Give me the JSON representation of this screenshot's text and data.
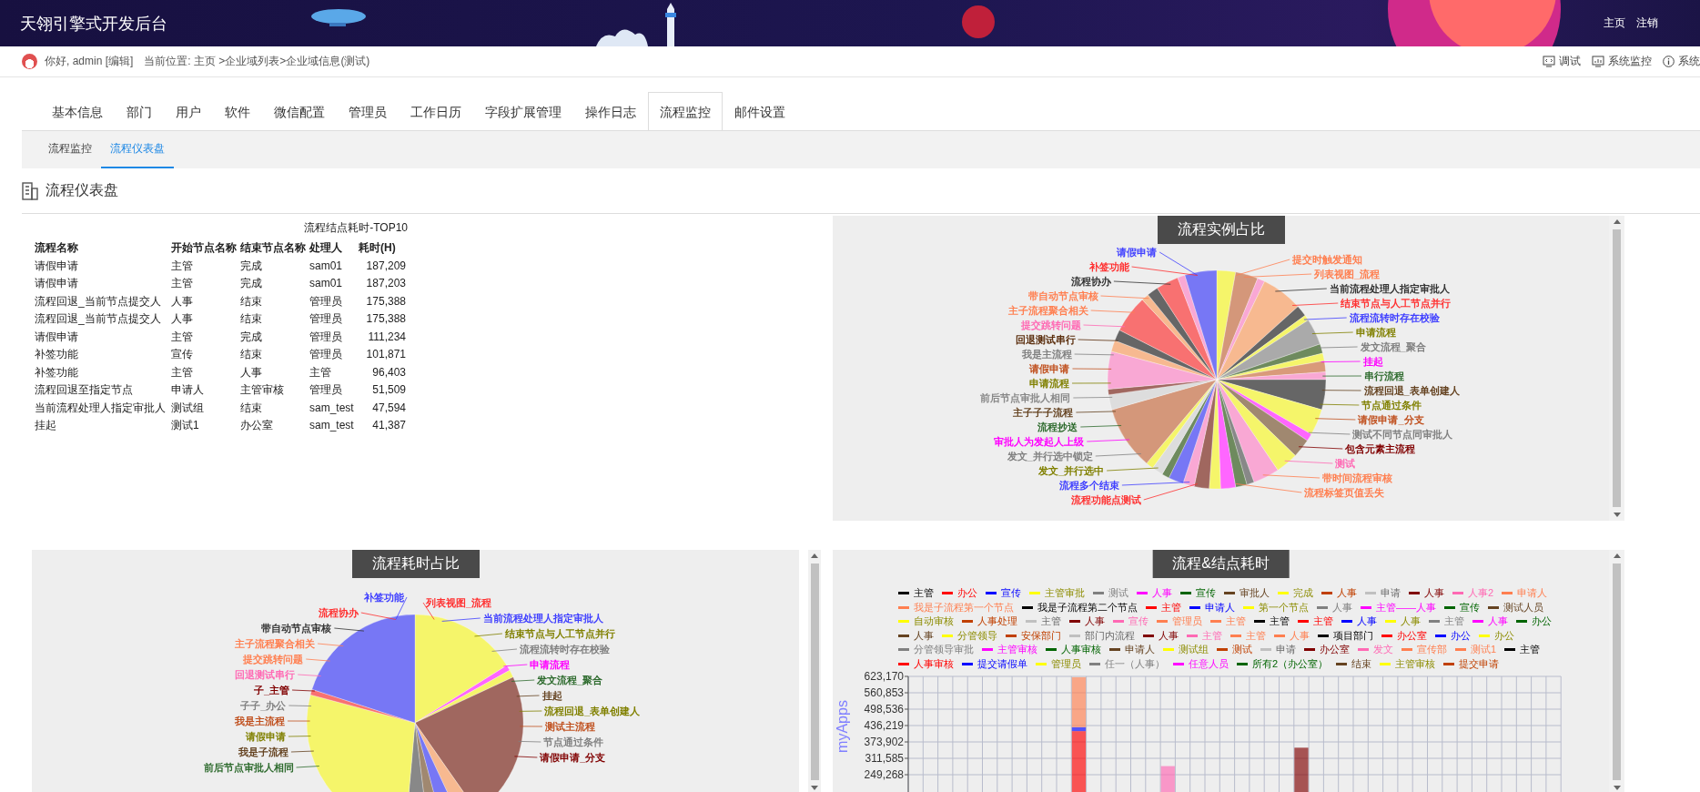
{
  "header": {
    "title": "天翎引擎式开发后台",
    "links": [
      "主页",
      "注销"
    ]
  },
  "user_bar": {
    "greeting": "你好, admin [编辑]",
    "breadcrumb": "当前位置: 主页 >企业域列表>企业域信息(测试)",
    "tools": [
      {
        "label": "调试",
        "kind": "debug"
      },
      {
        "label": "系统监控",
        "kind": "monitor"
      },
      {
        "label": "系统",
        "kind": "info"
      }
    ]
  },
  "tabs": [
    {
      "label": "基本信息",
      "selected": false
    },
    {
      "label": "部门",
      "selected": false
    },
    {
      "label": "用户",
      "selected": false
    },
    {
      "label": "软件",
      "selected": false
    },
    {
      "label": "微信配置",
      "selected": false
    },
    {
      "label": "管理员",
      "selected": false
    },
    {
      "label": "工作日历",
      "selected": false
    },
    {
      "label": "字段扩展管理",
      "selected": false
    },
    {
      "label": "操作日志",
      "selected": false
    },
    {
      "label": "流程监控",
      "selected": true
    },
    {
      "label": "邮件设置",
      "selected": false
    }
  ],
  "sub_tabs": [
    {
      "label": "流程监控",
      "selected": false
    },
    {
      "label": "流程仪表盘",
      "selected": true
    }
  ],
  "page_title": "流程仪表盘",
  "top10_table": {
    "title": "流程结点耗时-TOP10",
    "columns": [
      "流程名称",
      "开始节点名称",
      "结束节点名称",
      "处理人",
      "耗时(H)"
    ],
    "rows": [
      [
        "请假申请",
        "主管",
        "完成",
        "sam01",
        "187,209"
      ],
      [
        "请假申请",
        "主管",
        "完成",
        "sam01",
        "187,203"
      ],
      [
        "流程回退_当前节点提交人",
        "人事",
        "结束",
        "管理员",
        "175,388"
      ],
      [
        "流程回退_当前节点提交人",
        "人事",
        "结束",
        "管理员",
        "175,388"
      ],
      [
        "请假申请",
        "主管",
        "完成",
        "管理员",
        "111,234"
      ],
      [
        "补签功能",
        "宣传",
        "结束",
        "管理员",
        "101,871"
      ],
      [
        "补签功能",
        "主管",
        "人事",
        "主管",
        "96,403"
      ],
      [
        "流程回退至指定节点",
        "申请人",
        "主管审核",
        "管理员",
        "51,509"
      ],
      [
        "当前流程处理人指定审批人",
        "测试组",
        "结束",
        "sam_test",
        "47,594"
      ],
      [
        "挂起",
        "测试1",
        "办公室",
        "sam_test",
        "41,387"
      ]
    ]
  },
  "instance_pie": {
    "title": "流程实例占比",
    "left_labels": [
      {
        "text": "请假申请",
        "color": "#4040ff"
      },
      {
        "text": "补签功能",
        "color": "#ff3030"
      },
      {
        "text": "流程协办",
        "color": "#333333"
      },
      {
        "text": "带自动节点审核",
        "color": "#ff7f50"
      },
      {
        "text": "主子流程聚合相关",
        "color": "#ff7f50"
      },
      {
        "text": "提交跳转问题",
        "color": "#ff69b4"
      },
      {
        "text": "回退测试串行",
        "color": "#5a2d0c"
      },
      {
        "text": "我是主流程",
        "color": "#808080"
      },
      {
        "text": "请假申请",
        "color": "#c0501e"
      },
      {
        "text": "申请流程",
        "color": "#808000"
      },
      {
        "text": "前后节点审批人相同",
        "color": "#888888"
      },
      {
        "text": "主子子子流程",
        "color": "#654321"
      },
      {
        "text": "流程抄送",
        "color": "#2e6b2e"
      },
      {
        "text": "审批人为发起人上级",
        "color": "#ff00ff"
      },
      {
        "text": "发文_并行选中锁定",
        "color": "#808080"
      },
      {
        "text": "发文_并行选中",
        "color": "#808000"
      },
      {
        "text": "流程多个结束",
        "color": "#4040ff"
      },
      {
        "text": "流程功能点测试",
        "color": "#ff3030"
      }
    ],
    "right_labels": [
      {
        "text": "提交时触发通知",
        "color": "#ff7f50"
      },
      {
        "text": "列表视图_流程",
        "color": "#ff7f50"
      },
      {
        "text": "当前流程处理人指定审批人",
        "color": "#333333"
      },
      {
        "text": "结束节点与人工节点并行",
        "color": "#ff3030"
      },
      {
        "text": "流程流转时存在校验",
        "color": "#4040ff"
      },
      {
        "text": "申请流程",
        "color": "#808000"
      },
      {
        "text": "发文流程_聚合",
        "color": "#808080"
      },
      {
        "text": "挂起",
        "color": "#ff00ff"
      },
      {
        "text": "串行流程",
        "color": "#2e6b2e"
      },
      {
        "text": "流程回退_表单创建人",
        "color": "#654321"
      },
      {
        "text": "节点通过条件",
        "color": "#808000"
      },
      {
        "text": "请假申请_分支",
        "color": "#c0501e"
      },
      {
        "text": "测试不同节点同审批人",
        "color": "#808080"
      },
      {
        "text": "包含元素主流程",
        "color": "#800000"
      },
      {
        "text": "测试",
        "color": "#ff69b4"
      },
      {
        "text": "带时间流程审核",
        "color": "#ff7f50"
      },
      {
        "text": "流程标签页值丢失",
        "color": "#ff7f50"
      }
    ]
  },
  "duration_pie": {
    "title": "流程耗时占比",
    "left_labels": [
      {
        "text": "补签功能",
        "color": "#4040ff"
      },
      {
        "text": "流程协办",
        "color": "#ff3030"
      },
      {
        "text": "带自动节点审核",
        "color": "#333333"
      },
      {
        "text": "主子流程聚合相关",
        "color": "#ff7f50"
      },
      {
        "text": "提交跳转问题",
        "color": "#ff7f50"
      },
      {
        "text": "回退测试串行",
        "color": "#ff69b4"
      },
      {
        "text": "子_主管",
        "color": "#800000"
      },
      {
        "text": "子子_办公",
        "color": "#808080"
      },
      {
        "text": "我是主流程",
        "color": "#c0501e"
      },
      {
        "text": "请假申请",
        "color": "#808000"
      },
      {
        "text": "我是子流程",
        "color": "#654321"
      },
      {
        "text": "前后节点审批人相同",
        "color": "#2e6b2e"
      }
    ],
    "right_labels": [
      {
        "text": "列表视图_流程",
        "color": "#ff3030"
      },
      {
        "text": "当前流程处理人指定审批人",
        "color": "#4040ff"
      },
      {
        "text": "结束节点与人工节点并行",
        "color": "#808000"
      },
      {
        "text": "流程流转时存在校验",
        "color": "#808080"
      },
      {
        "text": "申请流程",
        "color": "#ff00ff"
      },
      {
        "text": "发文流程_聚合",
        "color": "#2e6b2e"
      },
      {
        "text": "挂起",
        "color": "#654321"
      },
      {
        "text": "流程回退_表单创建人",
        "color": "#808000"
      },
      {
        "text": "测试主流程",
        "color": "#c0501e"
      },
      {
        "text": "节点通过条件",
        "color": "#808080"
      },
      {
        "text": "请假申请_分支",
        "color": "#800000"
      }
    ]
  },
  "node_duration_chart": {
    "title": "流程&结点耗时",
    "chart_data": {
      "type": "bar",
      "stacked": true,
      "grid": true,
      "legend": "top",
      "ylabel": "myApps",
      "ylim": [
        0,
        623170
      ],
      "yticks": [
        {
          "value": 249268,
          "label": "249,268"
        },
        {
          "value": 311585,
          "label": "311,585"
        },
        {
          "value": 373902,
          "label": "373,902"
        },
        {
          "value": 436219,
          "label": "436,219"
        },
        {
          "value": 498536,
          "label": "498,536"
        },
        {
          "value": 560853,
          "label": "560,853"
        },
        {
          "value": 623170,
          "label": "623,170"
        }
      ],
      "series": [
        {
          "name": "主管",
          "color": "#000000"
        },
        {
          "name": "办公",
          "color": "#ff0000",
          "values": [
            null,
            null,
            null,
            null,
            null,
            null,
            null,
            null,
            null,
            null,
            null,
            415000,
            null,
            null,
            null,
            null,
            null,
            null,
            null,
            null,
            null,
            null,
            null,
            null,
            null,
            null,
            null,
            null,
            null,
            null,
            null,
            null,
            null,
            null,
            null,
            null,
            null,
            null,
            null,
            null,
            null,
            null,
            null,
            null
          ]
        },
        {
          "name": "宣传",
          "color": "#0000ff",
          "values": [
            null,
            null,
            null,
            null,
            null,
            null,
            null,
            null,
            null,
            null,
            null,
            15000,
            null,
            null,
            null,
            null,
            null,
            null,
            null,
            null,
            null,
            null,
            null,
            null,
            null,
            null,
            null,
            null,
            null,
            null,
            null,
            null,
            null,
            null,
            null,
            null,
            null,
            null,
            null,
            null,
            null,
            null,
            null,
            null
          ]
        },
        {
          "name": "主管审批",
          "color": "#ffff00"
        },
        {
          "name": "测试",
          "color": "#808080"
        },
        {
          "name": "人事",
          "color": "#ff00ff"
        },
        {
          "name": "宣传",
          "color": "#006400"
        },
        {
          "name": "审批人",
          "color": "#654321"
        },
        {
          "name": "完成",
          "color": "#ffff00"
        },
        {
          "name": "人事",
          "color": "#c04000"
        },
        {
          "name": "申请",
          "color": "#c0c0c0"
        },
        {
          "name": "人事",
          "color": "#800000",
          "values": [
            null,
            null,
            null,
            null,
            null,
            null,
            null,
            null,
            null,
            null,
            null,
            null,
            null,
            null,
            null,
            null,
            null,
            null,
            null,
            null,
            null,
            null,
            null,
            null,
            null,
            null,
            352000,
            null,
            null,
            null,
            null,
            null,
            null,
            null,
            null,
            null,
            null,
            null,
            null,
            null,
            null,
            null,
            null,
            null
          ]
        },
        {
          "name": "人事2",
          "color": "#ff69b4",
          "values": [
            null,
            null,
            null,
            null,
            null,
            null,
            null,
            null,
            null,
            null,
            null,
            null,
            null,
            null,
            null,
            null,
            null,
            282000,
            null,
            null,
            null,
            null,
            null,
            null,
            null,
            null,
            null,
            null,
            null,
            null,
            null,
            null,
            null,
            null,
            null,
            null,
            null,
            null,
            null,
            null,
            null,
            null,
            null,
            null
          ]
        },
        {
          "name": "申请人",
          "color": "#ff7f50",
          "values": [
            null,
            null,
            null,
            null,
            null,
            null,
            null,
            null,
            null,
            null,
            null,
            190000,
            null,
            null,
            null,
            null,
            null,
            null,
            null,
            null,
            null,
            null,
            null,
            null,
            null,
            null,
            null,
            null,
            null,
            null,
            null,
            null,
            null,
            null,
            null,
            null,
            null,
            null,
            null,
            null,
            null,
            null,
            null,
            null
          ]
        },
        {
          "name": "我是子流程第一个节点",
          "color": "#ff7f50"
        },
        {
          "name": "我是子流程第二个节点",
          "color": "#000000"
        },
        {
          "name": "主管",
          "color": "#ff0000"
        },
        {
          "name": "申请人",
          "color": "#0000ff"
        },
        {
          "name": "第一个节点",
          "color": "#ffff00"
        },
        {
          "name": "人事",
          "color": "#808080"
        },
        {
          "name": "主管——人事",
          "color": "#ff00ff"
        },
        {
          "name": "宣传",
          "color": "#006400"
        },
        {
          "name": "测试人员",
          "color": "#654321"
        },
        {
          "name": "自动审核",
          "color": "#ffff00"
        },
        {
          "name": "人事处理",
          "color": "#c04000"
        },
        {
          "name": "主管",
          "color": "#c0c0c0"
        },
        {
          "name": "人事",
          "color": "#800000"
        },
        {
          "name": "宣传",
          "color": "#ff69b4"
        },
        {
          "name": "管理员",
          "color": "#ff7f50"
        },
        {
          "name": "主管",
          "color": "#ff7f50"
        },
        {
          "name": "主管",
          "color": "#000000"
        },
        {
          "name": "主管",
          "color": "#ff0000"
        },
        {
          "name": "人事",
          "color": "#0000ff"
        },
        {
          "name": "人事",
          "color": "#ffff00"
        },
        {
          "name": "主管",
          "color": "#808080"
        },
        {
          "name": "人事",
          "color": "#ff00ff"
        },
        {
          "name": "办公",
          "color": "#006400"
        },
        {
          "name": "人事",
          "color": "#654321"
        },
        {
          "name": "分管领导",
          "color": "#ffff00"
        },
        {
          "name": "安保部门",
          "color": "#c04000"
        },
        {
          "name": "部门内流程",
          "color": "#c0c0c0"
        },
        {
          "name": "人事",
          "color": "#800000"
        },
        {
          "name": "主管",
          "color": "#ff69b4"
        },
        {
          "name": "主管",
          "color": "#ff7f50"
        },
        {
          "name": "人事",
          "color": "#ff7f50"
        },
        {
          "name": "项目部门",
          "color": "#000000"
        },
        {
          "name": "办公室",
          "color": "#ff0000"
        },
        {
          "name": "办公",
          "color": "#0000ff"
        },
        {
          "name": "办公",
          "color": "#ffff00"
        },
        {
          "name": "分管领导审批",
          "color": "#808080"
        },
        {
          "name": "主管审核",
          "color": "#ff00ff"
        },
        {
          "name": "人事审核",
          "color": "#006400"
        },
        {
          "name": "申请人",
          "color": "#654321"
        },
        {
          "name": "测试组",
          "color": "#ffff00"
        },
        {
          "name": "测试",
          "color": "#c04000"
        },
        {
          "name": "申请",
          "color": "#c0c0c0"
        },
        {
          "name": "办公室",
          "color": "#800000"
        },
        {
          "name": "发文",
          "color": "#ff69b4"
        },
        {
          "name": "宣传部",
          "color": "#ff7f50"
        },
        {
          "name": "测试1",
          "color": "#ff7f50"
        },
        {
          "name": "主管",
          "color": "#000000"
        },
        {
          "name": "人事审核",
          "color": "#ff0000"
        },
        {
          "name": "提交请假单",
          "color": "#0000ff"
        },
        {
          "name": "管理员",
          "color": "#ffff00"
        },
        {
          "name": "任一（人事）",
          "color": "#808080"
        },
        {
          "name": "任意人员",
          "color": "#ff00ff"
        },
        {
          "name": "所有2（办公室）",
          "color": "#006400"
        },
        {
          "name": "结束",
          "color": "#654321"
        },
        {
          "name": "主管审核",
          "color": "#ffff00"
        },
        {
          "name": "提交申请",
          "color": "#c04000"
        }
      ]
    }
  }
}
